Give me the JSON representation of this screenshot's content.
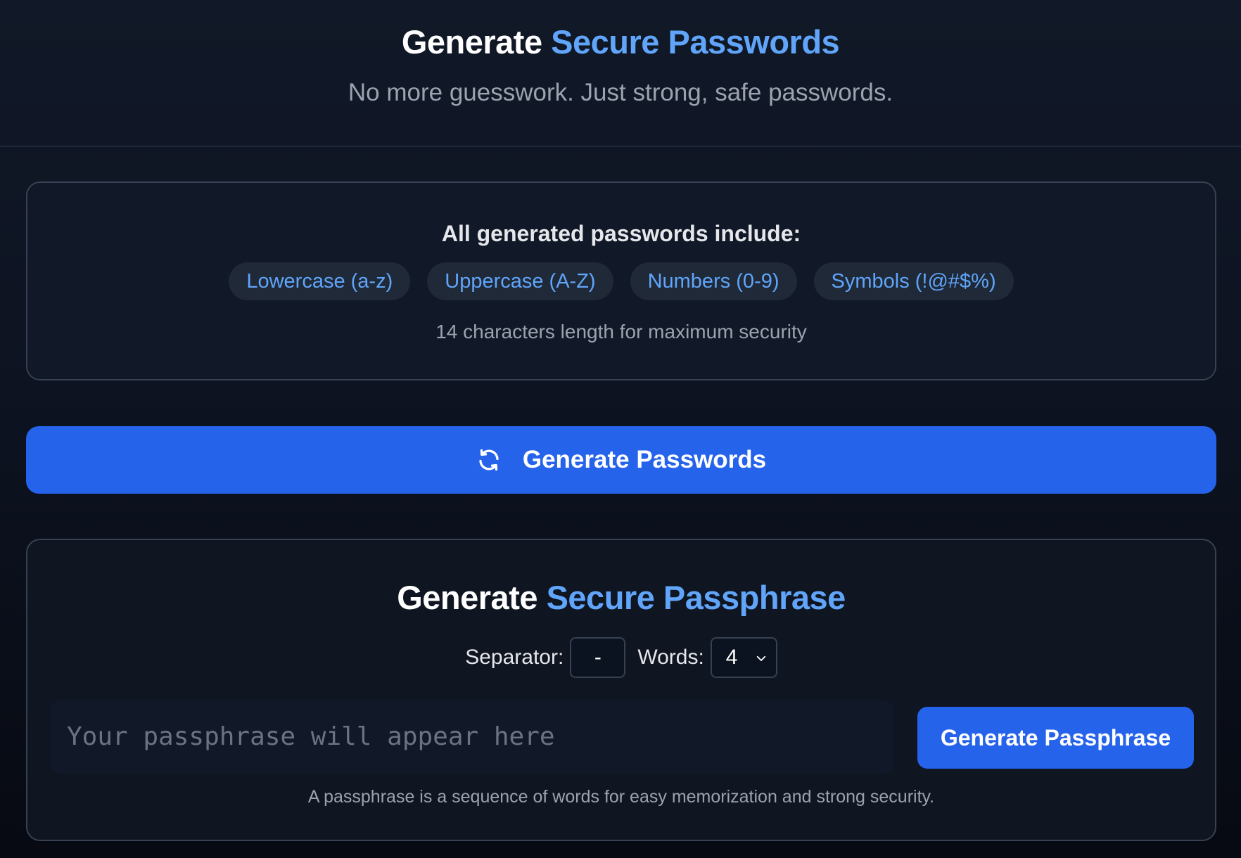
{
  "header": {
    "title_plain": "Generate",
    "title_accent": "Secure Passwords",
    "subtitle": "No more guesswork. Just strong, safe passwords."
  },
  "info": {
    "heading": "All generated passwords include:",
    "chips": [
      "Lowercase (a-z)",
      "Uppercase (A-Z)",
      "Numbers (0-9)",
      "Symbols (!@#$%)"
    ],
    "note": "14 characters length for maximum security"
  },
  "generate_button": {
    "icon": "refresh-icon",
    "label": "Generate Passwords"
  },
  "passphrase": {
    "title_plain": "Generate",
    "title_accent": "Secure Passphrase",
    "separator_label": "Separator:",
    "separator_value": "-",
    "words_label": "Words:",
    "words_value": "4",
    "output_placeholder": "Your passphrase will appear here",
    "button_label": "Generate Passphrase",
    "note": "A passphrase is a sequence of words for easy memorization and strong security."
  },
  "colors": {
    "accent": "#60a5fa",
    "button": "#2563eb",
    "background": "#111827"
  }
}
